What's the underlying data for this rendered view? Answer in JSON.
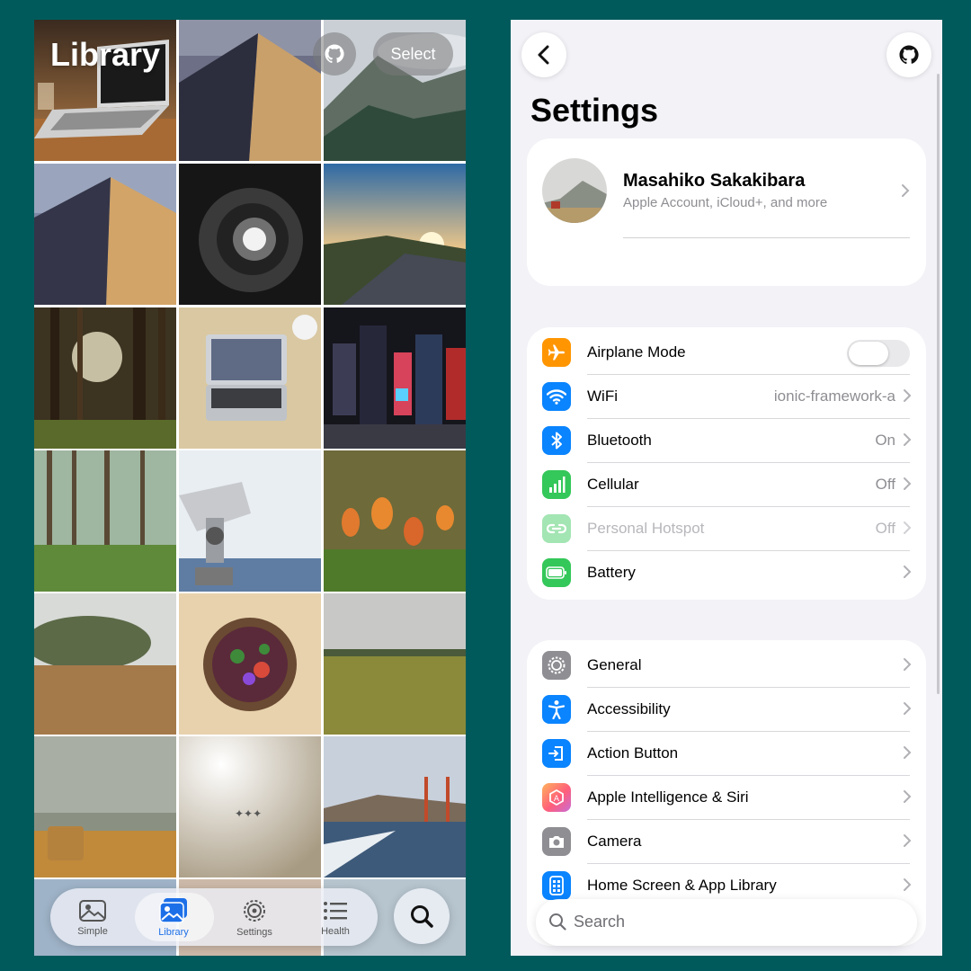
{
  "library": {
    "title": "Library",
    "github_icon": "github-icon",
    "select_label": "Select",
    "tabs": [
      {
        "label": "Simple",
        "icon": "photo-icon",
        "active": false
      },
      {
        "label": "Library",
        "icon": "photo-stack-icon",
        "active": true
      },
      {
        "label": "Settings",
        "icon": "gear-icon",
        "active": false
      },
      {
        "label": "Health",
        "icon": "list-icon",
        "active": false
      }
    ],
    "search_icon": "search-icon",
    "accent": "#1d6fe8"
  },
  "settings": {
    "title": "Settings",
    "profile": {
      "name": "Masahiko Sakakibara",
      "subtitle": "Apple Account, iCloud+, and more"
    },
    "group1": [
      {
        "label": "Airplane Mode",
        "icon": "airplane-icon",
        "color": "#ff9500",
        "value": "",
        "toggle": true,
        "toggle_on": false
      },
      {
        "label": "WiFi",
        "icon": "wifi-icon",
        "color": "#0a84ff",
        "value": "ionic-framework-a"
      },
      {
        "label": "Bluetooth",
        "icon": "bluetooth-icon",
        "color": "#0a84ff",
        "value": "On"
      },
      {
        "label": "Cellular",
        "icon": "cellular-icon",
        "color": "#34c759",
        "value": "Off"
      },
      {
        "label": "Personal Hotspot",
        "icon": "hotspot-icon",
        "color": "#34c759",
        "value": "Off",
        "disabled": true
      },
      {
        "label": "Battery",
        "icon": "battery-icon",
        "color": "#34c759",
        "value": ""
      }
    ],
    "group2": [
      {
        "label": "General",
        "icon": "gear-icon",
        "color": "#8e8e93"
      },
      {
        "label": "Accessibility",
        "icon": "accessibility-icon",
        "color": "#0a84ff"
      },
      {
        "label": "Action Button",
        "icon": "action-button-icon",
        "color": "#0a84ff"
      },
      {
        "label": "Apple Intelligence & Siri",
        "icon": "apple-intelligence-icon",
        "color": "#ff6f5e"
      },
      {
        "label": "Camera",
        "icon": "camera-icon",
        "color": "#8e8e93"
      },
      {
        "label": "Home Screen & App Library",
        "icon": "home-screen-icon",
        "color": "#0a84ff"
      }
    ],
    "search_placeholder": "Search"
  }
}
